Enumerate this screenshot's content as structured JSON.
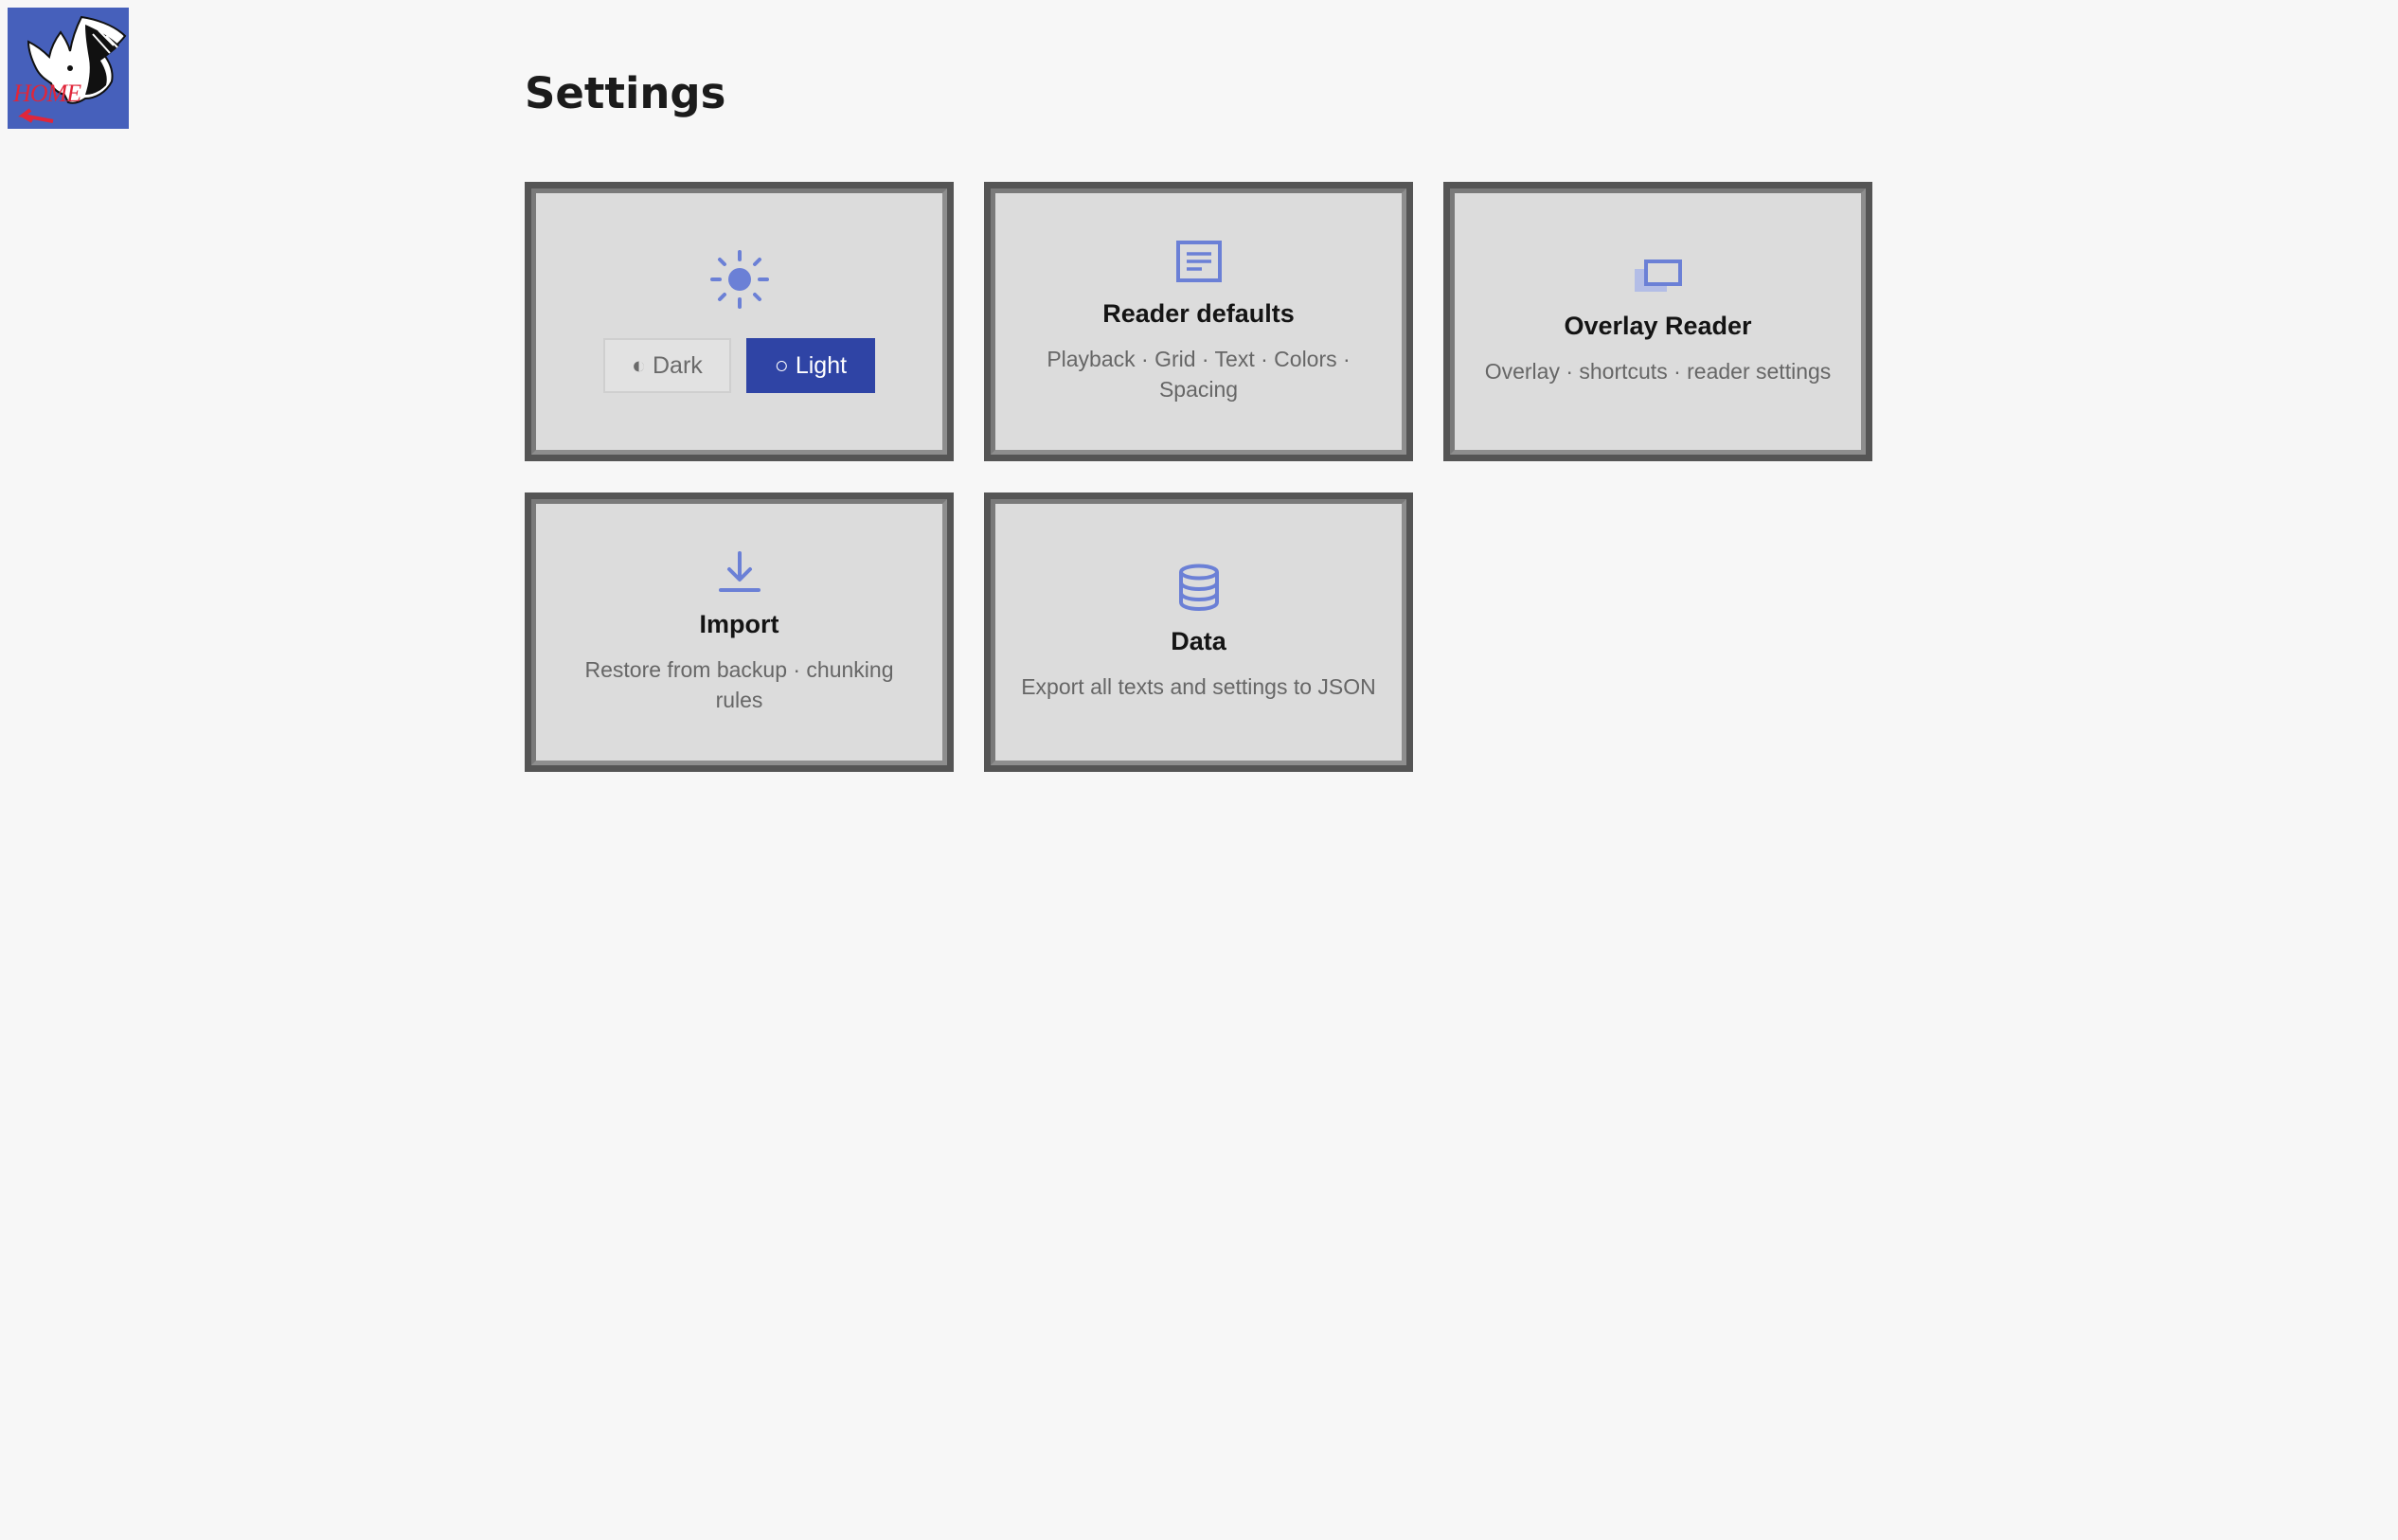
{
  "home": {
    "logo_text": "HOME"
  },
  "page": {
    "title": "Settings"
  },
  "theme_card": {
    "icon": "sun-icon",
    "dark_label": "◐ Dark",
    "light_label": "○ Light",
    "selected": "light"
  },
  "cards": {
    "reader": {
      "icon": "document-lines-icon",
      "title": "Reader defaults",
      "desc": "Playback · Grid · Text · Colors · Spacing"
    },
    "overlay": {
      "icon": "overlay-windows-icon",
      "title": "Overlay Reader",
      "desc": "Overlay · shortcuts · reader settings"
    },
    "import": {
      "icon": "download-icon",
      "title": "Import",
      "desc": "Restore from backup · chunking rules"
    },
    "data": {
      "icon": "database-icon",
      "title": "Data",
      "desc": "Export all texts and settings to JSON"
    }
  },
  "colors": {
    "accent": "#2f44a5",
    "icon": "#6b80d6",
    "logo_bg": "#4660bb",
    "logo_text": "#e0263a",
    "page_bg": "#f7f7f7"
  }
}
